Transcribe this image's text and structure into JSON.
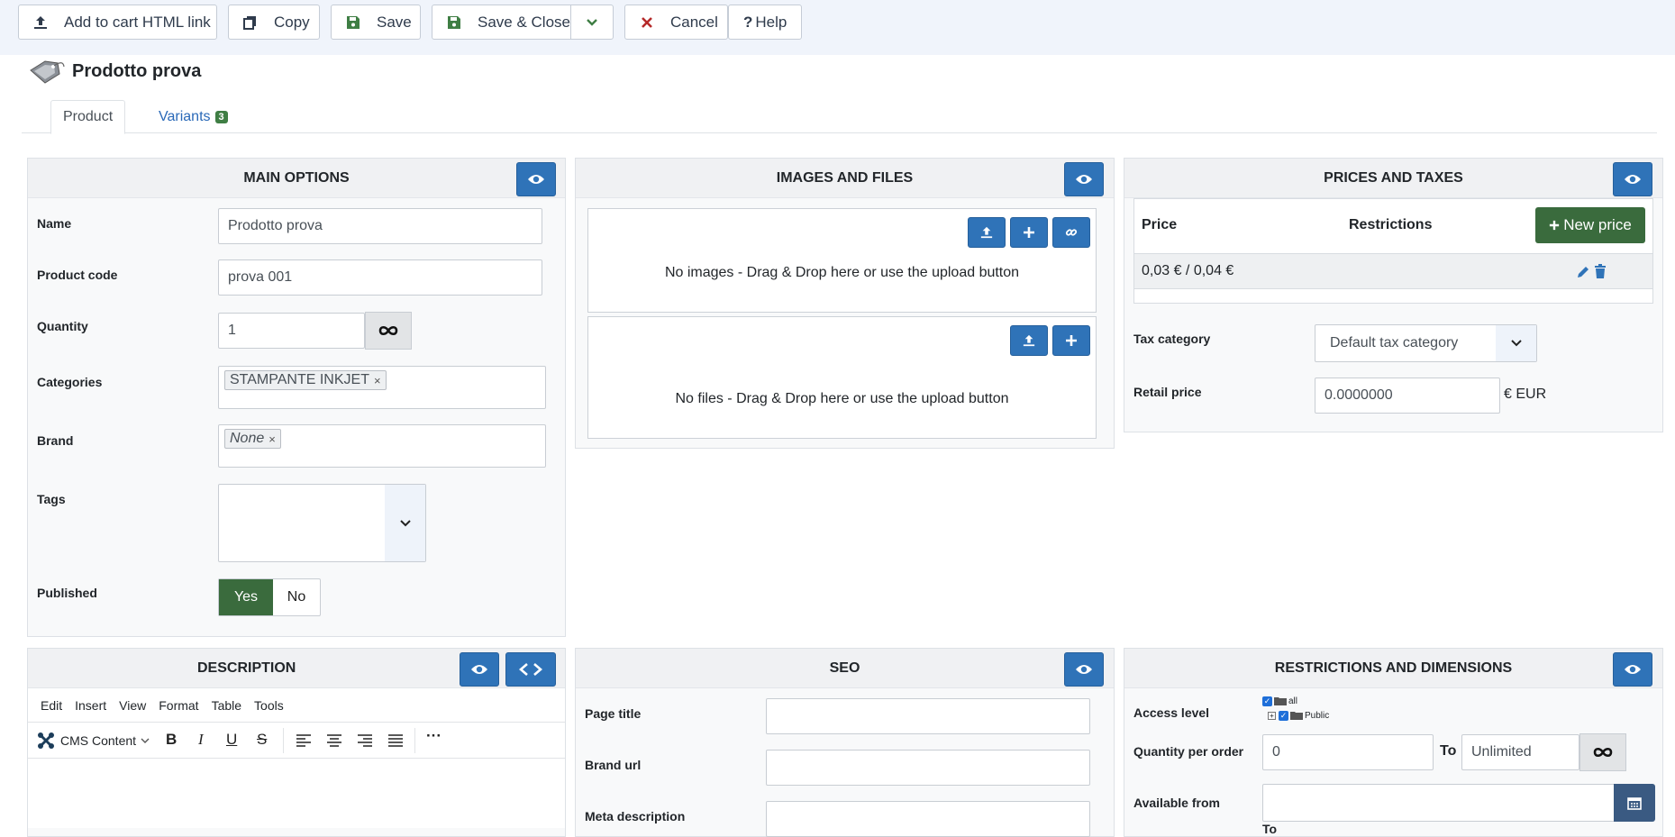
{
  "toolbar": {
    "add_to_cart": "Add to cart HTML link",
    "copy": "Copy",
    "save": "Save",
    "save_close": "Save & Close",
    "cancel": "Cancel",
    "help": "Help"
  },
  "page": {
    "title": "Prodotto prova"
  },
  "tabs": {
    "product": "Product",
    "variants": "Variants",
    "variants_count": "3"
  },
  "main_options": {
    "title": "MAIN OPTIONS",
    "name_label": "Name",
    "name_value": "Prodotto prova",
    "code_label": "Product code",
    "code_value": "prova 001",
    "qty_label": "Quantity",
    "qty_value": "1",
    "cat_label": "Categories",
    "cat_chip": "STAMPANTE INKJET",
    "brand_label": "Brand",
    "brand_chip": "None",
    "tags_label": "Tags",
    "published_label": "Published",
    "yes": "Yes",
    "no": "No"
  },
  "images": {
    "title": "IMAGES AND FILES",
    "no_images": "No images - Drag & Drop here or use the upload button",
    "no_files": "No files - Drag & Drop here or use the upload button"
  },
  "prices": {
    "title": "PRICES AND TAXES",
    "col_price": "Price",
    "col_restrictions": "Restrictions",
    "new_price": "New price",
    "row_price": "0,03 € / 0,04 €",
    "tax_label": "Tax category",
    "tax_value": "Default tax category",
    "retail_label": "Retail price",
    "retail_value": "0.0000000",
    "currency": "€ EUR"
  },
  "description": {
    "title": "DESCRIPTION",
    "menu": [
      "Edit",
      "Insert",
      "View",
      "Format",
      "Table",
      "Tools"
    ],
    "cms_content": "CMS Content"
  },
  "seo": {
    "title": "SEO",
    "page_title_label": "Page title",
    "brand_url_label": "Brand url",
    "meta_desc_label": "Meta description"
  },
  "restrictions": {
    "title": "RESTRICTIONS AND DIMENSIONS",
    "access_label": "Access level",
    "tree_all": "all",
    "tree_public": "Public",
    "qty_order_label": "Quantity per order",
    "qty_min": "0",
    "to": "To",
    "qty_max": "Unlimited",
    "available_label": "Available from",
    "to2": "To"
  },
  "colors": {
    "primary": "#2f73b8",
    "success": "#3f7e44",
    "danger": "#b52a2a"
  }
}
